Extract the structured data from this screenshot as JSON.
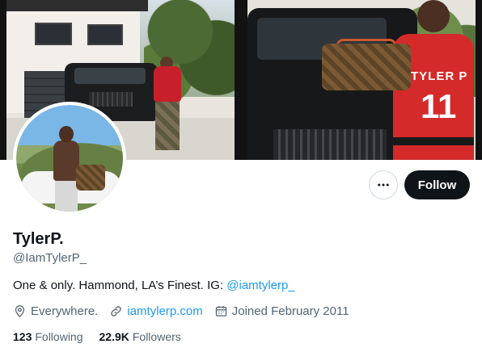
{
  "banner": {
    "left_jersey": "TYLER P",
    "right_jersey": "TYLER P",
    "right_jersey_number": "11"
  },
  "actions": {
    "more_icon": "more-horizontal-icon",
    "follow_label": "Follow"
  },
  "profile": {
    "display_name": "TylerP.",
    "handle": "@IamTylerP_",
    "bio_text": "One & only. Hammond, LA’s Finest. IG: ",
    "bio_link": "@iamtylerp_",
    "location": "Everywhere.",
    "website": "iamtylerp.com",
    "joined": "Joined February 2011"
  },
  "stats": {
    "following_count": "123",
    "following_label": "Following",
    "followers_count": "22.9K",
    "followers_label": "Followers"
  },
  "colors": {
    "accent": "#1d9bf0",
    "text_primary": "#0f1419",
    "text_secondary": "#536471",
    "follow_bg": "#0f1419"
  }
}
